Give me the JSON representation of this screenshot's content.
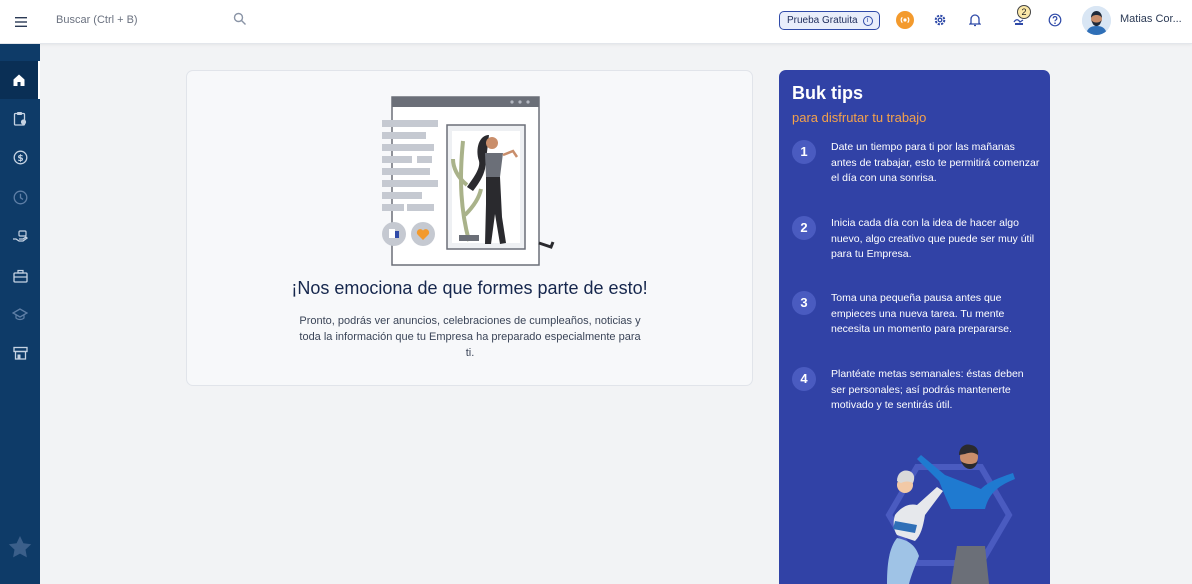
{
  "topbar": {
    "search_placeholder": "Buscar (Ctrl + B)",
    "trial_label": "Prueba Gratuita",
    "notification_count": "2",
    "user_name": "Matias Cor..."
  },
  "sidebar": {
    "items": [
      "home-icon",
      "clipboard-icon",
      "dollar-icon",
      "clock-icon",
      "hand-money-icon",
      "briefcase-icon",
      "graduation-icon",
      "store-icon",
      "star-icon"
    ]
  },
  "welcome": {
    "title": "¡Nos emociona de que formes parte de esto!",
    "text": "Pronto, podrás ver anuncios, celebraciones de cumpleaños, noticias y toda la información que tu Empresa ha preparado especialmente para ti."
  },
  "tips": {
    "title": "Buk tips",
    "subtitle": "para disfrutar tu trabajo",
    "items": [
      {
        "number": "1",
        "text": "Date un tiempo para ti por las mañanas antes de trabajar, esto te permitirá comenzar el día con una sonrisa."
      },
      {
        "number": "2",
        "text": "Inicia cada día con la idea de hacer algo nuevo, algo creativo que puede ser muy útil para tu Empresa."
      },
      {
        "number": "3",
        "text": "Toma una pequeña pausa antes que empieces una nueva tarea. Tu mente necesita un momento para prepararse."
      },
      {
        "number": "4",
        "text": "Plantéate metas semanales: éstas deben ser personales; así podrás mantenerte motivado y te sentirás útil."
      }
    ]
  },
  "colors": {
    "sidebar": "#0e3b68",
    "tips_background": "#3142a6",
    "accent_orange": "#f5a24a"
  }
}
